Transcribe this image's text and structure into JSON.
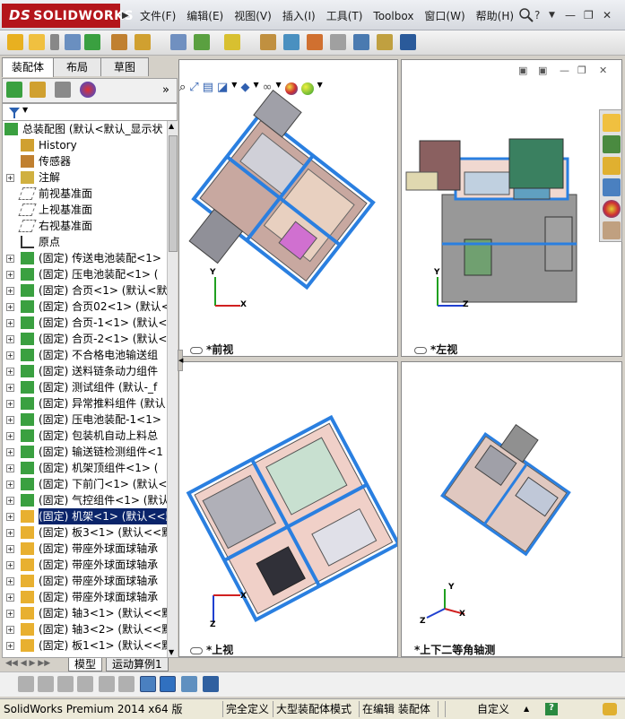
{
  "app": {
    "logo_text": "SOLIDWORKS",
    "logo_ds": "DS",
    "version_status": "SolidWorks Premium 2014 x64 版"
  },
  "menu": [
    "文件(F)",
    "编辑(E)",
    "视图(V)",
    "插入(I)",
    "工具(T)",
    "Toolbox",
    "窗口(W)",
    "帮助(H)"
  ],
  "window_controls": {
    "help": "?",
    "minimize": "▭",
    "restore": "❐",
    "close": "✕"
  },
  "feature_manager": {
    "tabs": [
      "装配体",
      "布局",
      "草图"
    ],
    "active_tab": "装配体",
    "tree": [
      {
        "label": "总装配图  (默认<默认_显示状",
        "indent": 0,
        "icon": "assembly-icon",
        "expand": ""
      },
      {
        "label": "History",
        "indent": 1,
        "icon": "history-icon",
        "expand": ""
      },
      {
        "label": "传感器",
        "indent": 1,
        "icon": "sensor-icon",
        "expand": ""
      },
      {
        "label": "注解",
        "indent": 1,
        "icon": "annotation-icon",
        "expand": "+"
      },
      {
        "label": "前视基准面",
        "indent": 1,
        "icon": "plane-icon",
        "expand": ""
      },
      {
        "label": "上视基准面",
        "indent": 1,
        "icon": "plane-icon",
        "expand": ""
      },
      {
        "label": "右视基准面",
        "indent": 1,
        "icon": "plane-icon",
        "expand": ""
      },
      {
        "label": "原点",
        "indent": 1,
        "icon": "origin-icon",
        "expand": ""
      },
      {
        "label": "(固定) 传送电池装配<1>",
        "indent": 1,
        "icon": "subassembly-icon",
        "expand": "+"
      },
      {
        "label": "(固定) 压电池装配<1> (",
        "indent": 1,
        "icon": "subassembly-icon",
        "expand": "+"
      },
      {
        "label": "(固定) 合页<1> (默认<默",
        "indent": 1,
        "icon": "subassembly-icon",
        "expand": "+"
      },
      {
        "label": "(固定) 合页02<1> (默认<",
        "indent": 1,
        "icon": "subassembly-icon",
        "expand": "+"
      },
      {
        "label": "(固定) 合页-1<1> (默认<",
        "indent": 1,
        "icon": "subassembly-icon",
        "expand": "+"
      },
      {
        "label": "(固定) 合页-2<1> (默认<",
        "indent": 1,
        "icon": "subassembly-icon",
        "expand": "+"
      },
      {
        "label": "(固定) 不合格电池输送组",
        "indent": 1,
        "icon": "subassembly-icon",
        "expand": "+"
      },
      {
        "label": "(固定) 送料链条动力组件",
        "indent": 1,
        "icon": "subassembly-icon",
        "expand": "+"
      },
      {
        "label": "(固定) 测试组件 (默认-_f",
        "indent": 1,
        "icon": "subassembly-icon",
        "expand": "+"
      },
      {
        "label": "(固定) 异常推料组件 (默认",
        "indent": 1,
        "icon": "subassembly-icon",
        "expand": "+"
      },
      {
        "label": "(固定) 压电池装配-1<1>",
        "indent": 1,
        "icon": "subassembly-icon",
        "expand": "+"
      },
      {
        "label": "(固定) 包装机自动上料总",
        "indent": 1,
        "icon": "subassembly-icon",
        "expand": "+"
      },
      {
        "label": "(固定) 输送链检测组件<1",
        "indent": 1,
        "icon": "subassembly-icon",
        "expand": "+"
      },
      {
        "label": "(固定) 机架顶组件<1> (",
        "indent": 1,
        "icon": "subassembly-icon",
        "expand": "+"
      },
      {
        "label": "(固定) 下前门<1> (默认<",
        "indent": 1,
        "icon": "subassembly-icon",
        "expand": "+"
      },
      {
        "label": "(固定) 气控组件<1> (默认",
        "indent": 1,
        "icon": "subassembly-icon",
        "expand": "+"
      },
      {
        "label": "(固定) 机架<1> (默认<<默",
        "indent": 1,
        "icon": "part-icon",
        "expand": "+",
        "selected": true
      },
      {
        "label": "(固定) 板3<1> (默认<<默",
        "indent": 1,
        "icon": "part-icon",
        "expand": "+"
      },
      {
        "label": "(固定) 带座外球面球轴承",
        "indent": 1,
        "icon": "part-icon",
        "expand": "+"
      },
      {
        "label": "(固定) 带座外球面球轴承",
        "indent": 1,
        "icon": "part-icon",
        "expand": "+"
      },
      {
        "label": "(固定) 带座外球面球轴承",
        "indent": 1,
        "icon": "part-icon",
        "expand": "+"
      },
      {
        "label": "(固定) 带座外球面球轴承",
        "indent": 1,
        "icon": "part-icon",
        "expand": "+"
      },
      {
        "label": "(固定) 轴3<1> (默认<<默",
        "indent": 1,
        "icon": "part-icon",
        "expand": "+"
      },
      {
        "label": "(固定) 轴3<2> (默认<<默",
        "indent": 1,
        "icon": "part-icon",
        "expand": "+"
      },
      {
        "label": "(固定) 板1<1> (默认<<默",
        "indent": 1,
        "icon": "part-icon",
        "expand": "+"
      }
    ]
  },
  "viewports": [
    {
      "name": "前视",
      "axis_a": "Y",
      "axis_b": "X"
    },
    {
      "name": "左视",
      "axis_a": "Y",
      "axis_b": "Z"
    },
    {
      "name": "上视",
      "axis_a": "Z",
      "axis_b": "X"
    },
    {
      "name": "上下二等角轴测",
      "axis_a": "Y",
      "axis_b": "X",
      "axis_c": "Z"
    }
  ],
  "bottom_tabs": [
    "模型",
    "运动算例1"
  ],
  "status": {
    "constraint": "完全定义",
    "mode": "大型装配体模式",
    "editing": "在编辑 装配体",
    "units": "自定义",
    "help": "?"
  },
  "colors": {
    "frame_blue": "#2a7fe0",
    "solidworks_red": "#b4151b",
    "selection": "#0a246a"
  }
}
